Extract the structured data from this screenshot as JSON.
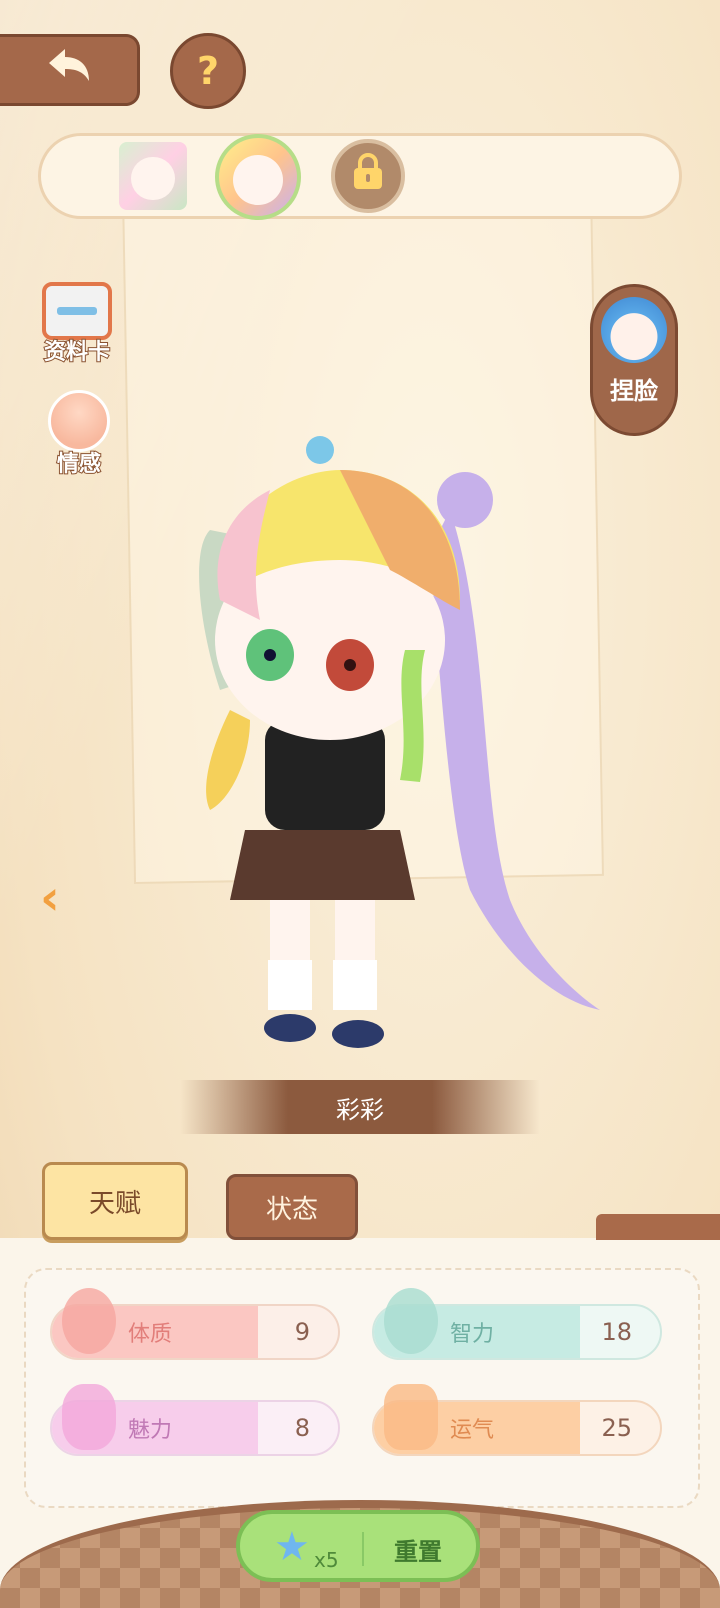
{
  "header": {
    "back_icon": "back-arrow-icon",
    "help_label": "?"
  },
  "selector": {
    "slots": [
      {
        "state": "owned"
      },
      {
        "state": "selected"
      },
      {
        "state": "locked",
        "icon": "lock-icon"
      }
    ]
  },
  "sidebar": {
    "profile_card_label": "资料卡",
    "emotion_label": "情感",
    "face_edit_label": "捏脸"
  },
  "character": {
    "name": "彩彩"
  },
  "tabs": {
    "talent_label": "天赋",
    "status_label": "状态"
  },
  "stats": {
    "physique": {
      "label": "体质",
      "value": "9"
    },
    "intelligence": {
      "label": "智力",
      "value": "18"
    },
    "charm": {
      "label": "魅力",
      "value": "8"
    },
    "luck": {
      "label": "运气",
      "value": "25"
    }
  },
  "reset": {
    "count": "x5",
    "label": "重置"
  },
  "colors": {
    "brown": "#a4684a",
    "accent_yellow": "#ffd56a",
    "green_button": "#a9e17a"
  }
}
